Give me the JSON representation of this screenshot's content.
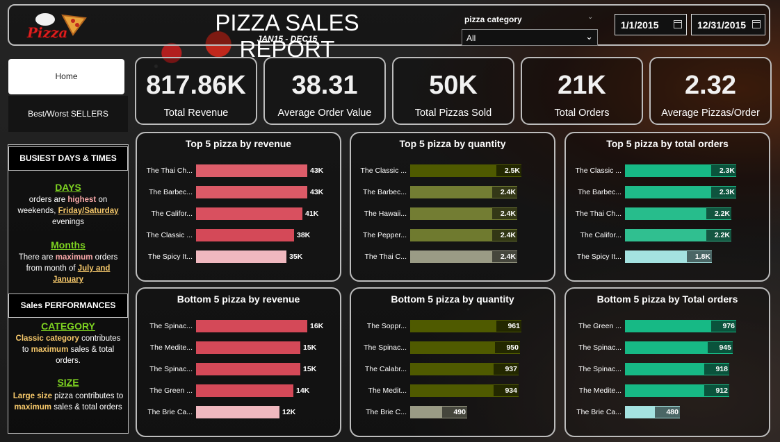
{
  "header": {
    "title": "PIZZA SALES REPORT",
    "subtitle": "JAN15 - DEC15",
    "logo_text": "Pizza",
    "category_label": "pizza category",
    "category_value": "All",
    "date_start": "1/1/2015",
    "date_end": "12/31/2015"
  },
  "nav": {
    "home": "Home",
    "best_worst": "Best/Worst SELLERS"
  },
  "sidebar": {
    "busiest_title": "BUSIEST DAYS & TIMES",
    "days_heading": "DAYS",
    "days_text": [
      "orders are",
      "highest",
      "on weekends,",
      "Friday/Saturday",
      "evenings"
    ],
    "months_heading": "Months",
    "months_text": [
      "There are",
      "maximum",
      "orders from month of",
      "July and January"
    ],
    "perf_title": "Sales PERFORMANCES",
    "category_heading": "CATEGORY",
    "category_text": [
      "Classic category",
      "contributes to",
      "maximum",
      "sales & total orders."
    ],
    "size_heading": "SIZE",
    "size_text": [
      "Large size",
      "pizza contributes to",
      "maximum",
      "sales & total orders"
    ]
  },
  "kpis": [
    {
      "value": "817.86K",
      "label": "Total Revenue"
    },
    {
      "value": "38.31",
      "label": "Average Order Value"
    },
    {
      "value": "50K",
      "label": "Total Pizzas Sold"
    },
    {
      "value": "21K",
      "label": "Total Orders"
    },
    {
      "value": "2.32",
      "label": "Average Pizzas/Order"
    }
  ],
  "chart_data": [
    {
      "type": "bar",
      "title": "Top 5 pizza by revenue",
      "categories": [
        "The Thai Ch...",
        "The Barbec...",
        "The Califor...",
        "The Classic ...",
        "The Spicy It..."
      ],
      "values": [
        43,
        43,
        41,
        38,
        35
      ],
      "labels": [
        "43K",
        "43K",
        "41K",
        "38K",
        "35K"
      ],
      "colors": [
        "#dd5d6a",
        "#dc5a67",
        "#d9505f",
        "#d44958",
        "#f0b8bf"
      ]
    },
    {
      "type": "bar",
      "title": "Top 5 pizza by quantity",
      "categories": [
        "The Classic ...",
        "The Barbec...",
        "The Hawaii...",
        "The Pepper...",
        "The Thai C..."
      ],
      "values": [
        2.5,
        2.4,
        2.4,
        2.4,
        2.4
      ],
      "labels": [
        "2.5K",
        "2.4K",
        "2.4K",
        "2.4K",
        "2.4K"
      ],
      "colors": [
        "#4f5a00",
        "#737d33",
        "#737d33",
        "#6f7a2f",
        "#9a9b85"
      ]
    },
    {
      "type": "bar",
      "title": "Top 5 pizza by total orders",
      "categories": [
        "The Classic ...",
        "The Barbec...",
        "The Thai Ch...",
        "The Califor...",
        "The Spicy It..."
      ],
      "values": [
        2.3,
        2.3,
        2.2,
        2.2,
        1.8
      ],
      "labels": [
        "2.3K",
        "2.3K",
        "2.2K",
        "2.2K",
        "1.8K"
      ],
      "colors": [
        "#17b985",
        "#1fbb89",
        "#27bd8c",
        "#30bf90",
        "#a4e2e0"
      ]
    },
    {
      "type": "bar",
      "title": "Bottom 5 pizza by revenue",
      "categories": [
        "The Spinac...",
        "The Medite...",
        "The Spinac...",
        "The Green ...",
        "The Brie Ca..."
      ],
      "values": [
        16,
        15,
        15,
        14,
        12
      ],
      "labels": [
        "16K",
        "15K",
        "15K",
        "14K",
        "12K"
      ],
      "colors": [
        "#d44958",
        "#d44958",
        "#d44958",
        "#d44958",
        "#f0b8bf"
      ]
    },
    {
      "type": "bar",
      "title": "Bottom 5 pizza by quantity",
      "categories": [
        "The Soppr...",
        "The Spinac...",
        "The Calabr...",
        "The Medit...",
        "The Brie C..."
      ],
      "values": [
        961,
        950,
        937,
        934,
        490
      ],
      "labels": [
        "961",
        "950",
        "937",
        "934",
        "490"
      ],
      "colors": [
        "#4f5a00",
        "#4f5a00",
        "#4f5a00",
        "#4f5a00",
        "#9a9b85"
      ]
    },
    {
      "type": "bar",
      "title": "Bottom 5 pizza by Total orders",
      "categories": [
        "The Green ...",
        "The Spinac...",
        "The Spinac...",
        "The Medite...",
        "The Brie Ca..."
      ],
      "values": [
        976,
        945,
        918,
        912,
        480
      ],
      "labels": [
        "976",
        "945",
        "918",
        "912",
        "480"
      ],
      "colors": [
        "#17b985",
        "#17b985",
        "#17b985",
        "#17b985",
        "#a4e2e0"
      ]
    }
  ]
}
